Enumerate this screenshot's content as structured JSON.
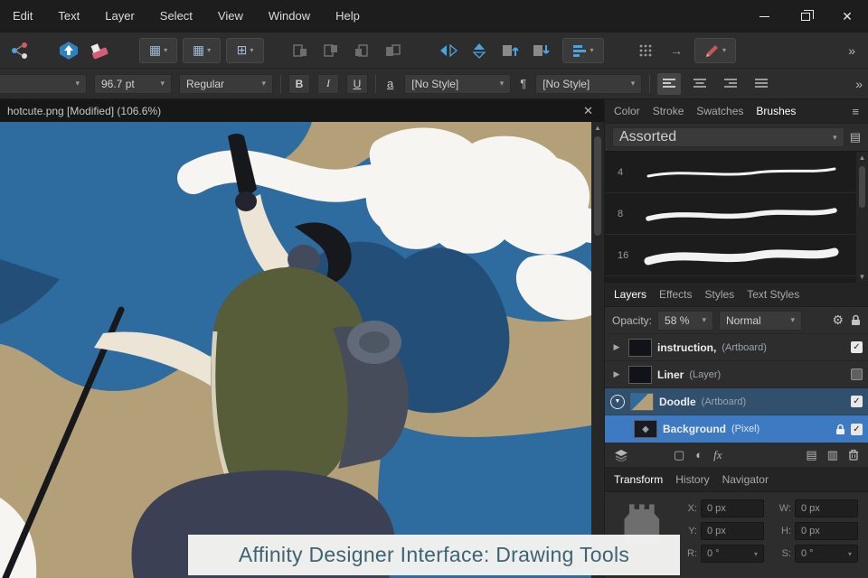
{
  "menu": {
    "items": [
      "Edit",
      "Text",
      "Layer",
      "Select",
      "View",
      "Window",
      "Help"
    ]
  },
  "window_controls": {
    "close": "✕"
  },
  "toolbar": {
    "overflow": "»"
  },
  "context_toolbar": {
    "font_size": "96.7 pt",
    "font_style": "Regular",
    "bold": "B",
    "italic": "I",
    "underline": "U",
    "underline_char": "a",
    "char_style": "[No Style]",
    "pilcrow": "¶",
    "para_style": "[No Style]",
    "overflow": "»"
  },
  "document": {
    "tab_title": "hotcute.png [Modified] (106.6%)",
    "close": "✕"
  },
  "studio": {
    "tabs": [
      "Color",
      "Stroke",
      "Swatches",
      "Brushes"
    ],
    "menu_icon": "≡",
    "category": "Assorted",
    "panel_icon": "▤",
    "brushes": [
      {
        "size": "4"
      },
      {
        "size": "8"
      },
      {
        "size": "16"
      }
    ]
  },
  "layers_panel": {
    "tabs": [
      "Layers",
      "Effects",
      "Styles",
      "Text Styles"
    ],
    "opacity_label": "Opacity:",
    "opacity_value": "58 %",
    "blend_mode": "Normal",
    "gear_icon": "⚙",
    "layers": [
      {
        "name": "instruction,",
        "type": "(Artboard)"
      },
      {
        "name": "Liner",
        "type": "(Layer)"
      },
      {
        "name": "Doodle",
        "type": "(Artboard)"
      },
      {
        "name": "Background",
        "type": "(Pixel)"
      }
    ],
    "footer": {
      "mask_icon": "▢",
      "adjust_icon": "◐",
      "fx": "fx",
      "new_icon": "▤",
      "export_icon": "▥"
    },
    "diamond_icon": "◆"
  },
  "transform_panel": {
    "tabs": [
      "Transform",
      "History",
      "Navigator"
    ],
    "fields": [
      {
        "label": "X:",
        "value": "0 px"
      },
      {
        "label": "W:",
        "value": "0 px"
      },
      {
        "label": "Y:",
        "value": "0 px"
      },
      {
        "label": "H:",
        "value": "0 px"
      },
      {
        "label": "R:",
        "value": "0 °"
      },
      {
        "label": "S:",
        "value": "0 °"
      }
    ]
  },
  "caption": {
    "text": "Affinity Designer Interface: Drawing Tools"
  },
  "colors": {
    "accent": "#2f7fc1",
    "selected_layer": "#3e7ac2",
    "selected_group": "#31506e"
  }
}
